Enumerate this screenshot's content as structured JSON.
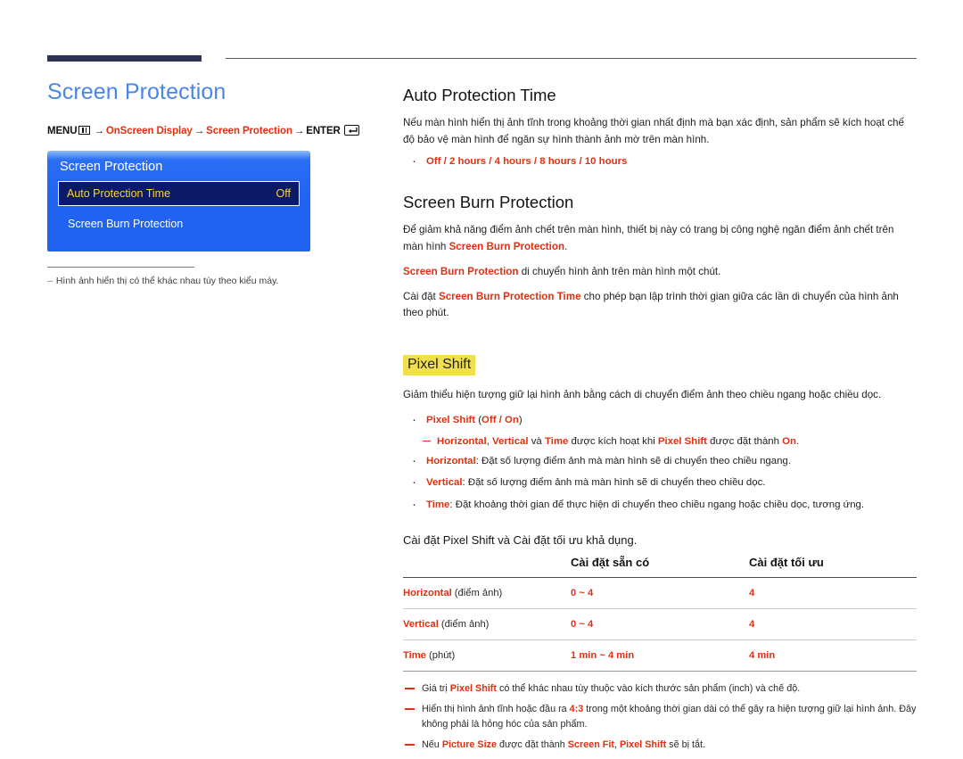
{
  "rules": {
    "thick_color": "#2c3354",
    "thin_color": "#585f73"
  },
  "left": {
    "title": "Screen Protection",
    "menu_path": {
      "menu_label": "MENU",
      "arrow": "→",
      "step1": "OnScreen Display",
      "step2": "Screen Protection",
      "enter_label": "ENTER"
    },
    "osd": {
      "title": "Screen Protection",
      "rows": [
        {
          "label": "Auto Protection Time",
          "value": "Off",
          "selected": true
        },
        {
          "label": "Screen Burn Protection",
          "value": "",
          "selected": false
        }
      ]
    },
    "note": "Hình ảnh hiển thị có thể khác nhau tùy theo kiểu máy."
  },
  "right": {
    "auto_protection": {
      "heading": "Auto Protection Time",
      "paragraph": "Nếu màn hình hiển thị ảnh tĩnh trong khoảng thời gian nhất định mà bạn xác định, sản phẩm sẽ kích hoạt chế độ bảo vệ màn hình để ngăn sự hình thành ảnh mờ trên màn hình.",
      "options": "Off / 2 hours / 4 hours / 8 hours / 10 hours"
    },
    "burn_protection": {
      "heading": "Screen Burn Protection",
      "p1_a": "Để giảm khả năng điểm ảnh chết trên màn hình, thiết bị này có trang bị công nghệ ngăn điểm ảnh chết trên màn hình ",
      "p1_term": "Screen Burn Protection",
      "p1_b": ".",
      "p2_term": "Screen Burn Protection",
      "p2_rest": " di chuyển hình ảnh trên màn hình một chút.",
      "p3_a": "Cài đặt ",
      "p3_term": "Screen Burn Protection Time",
      "p3_b": " cho phép bạn lập trình thời gian giữa các lần di chuyển của hình ảnh theo phút."
    },
    "pixel_shift": {
      "heading": "Pixel Shift",
      "heading_highlight_color": "#f0e04f",
      "intro": "Giảm thiểu hiện tượng giữ lại hình ảnh bằng cách di chuyển điểm ảnh theo chiều ngang hoặc chiều dọc.",
      "bullets": [
        {
          "term": "Pixel Shift",
          "rest": " (Off / On)",
          "options": "Off / On",
          "type": "options"
        },
        {
          "type": "sub",
          "text_parts": [
            "Horizontal",
            ", ",
            "Vertical",
            " và ",
            "Time",
            " được kích hoạt khi ",
            "Pixel Shift",
            " được đặt thành ",
            "On",
            "."
          ]
        },
        {
          "term": "Horizontal",
          "rest": ": Đặt số lượng điểm ảnh mà màn hình sẽ di chuyển theo chiều ngang.",
          "type": "item"
        },
        {
          "term": "Vertical",
          "rest": ": Đặt số lượng điểm ảnh mà màn hình sẽ di chuyển theo chiều dọc.",
          "type": "item"
        },
        {
          "term": "Time",
          "rest": ": Đặt khoảng thời gian để thực hiện di chuyển theo chiều ngang hoặc chiều dọc, tương ứng.",
          "type": "item"
        }
      ],
      "table_lead": "Cài đặt Pixel Shift và Cài đặt tối ưu khả dụng."
    },
    "table": {
      "headers": [
        "",
        "Cài đặt sẵn có",
        "Cài đặt tối ưu"
      ],
      "rows": [
        {
          "label": "Horizontal",
          "unit": " (điểm ảnh)",
          "available": "0 ~ 4",
          "optimum": "4"
        },
        {
          "label": "Vertical",
          "unit": " (điểm ảnh)",
          "available": "0 ~ 4",
          "optimum": "4"
        },
        {
          "label": "Time",
          "unit": " (phút)",
          "available": "1 min ~ 4 min",
          "optimum": "4 min"
        }
      ]
    },
    "footnotes": [
      {
        "parts": [
          "Giá trị ",
          "Pixel Shift",
          " có thể khác nhau tùy thuộc vào kích thước sản phẩm (inch) và chế độ."
        ]
      },
      {
        "parts": [
          "Hiển thị hình ảnh tĩnh hoặc đầu ra ",
          "4:3",
          " trong một khoảng thời gian dài có thể gây ra hiện tượng giữ lại hình ảnh. Đây không phải là hỏng hóc của sản phẩm."
        ]
      },
      {
        "parts": [
          "Nếu ",
          "Picture Size",
          " được đặt thành ",
          "Screen Fit",
          ", ",
          "Pixel Shift",
          " sẽ bị tắt."
        ]
      }
    ]
  }
}
